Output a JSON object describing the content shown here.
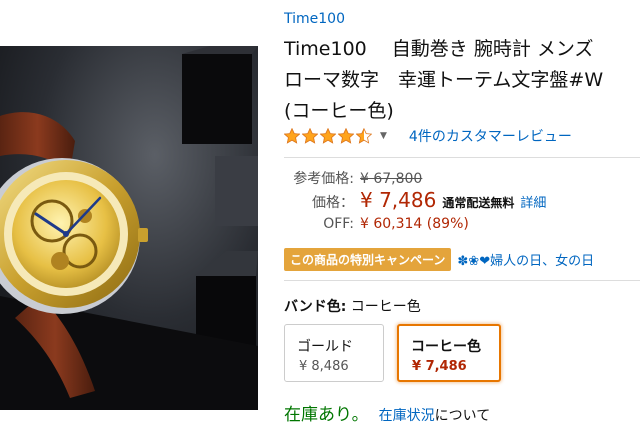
{
  "product": {
    "brand": "Time100",
    "title_lines": [
      "Time100　 自動巻き 腕時計 メンズ",
      "ローマ数字　幸運トーテム文字盤#W",
      "(コーヒー色)"
    ],
    "rating": 4.5,
    "reviews_label": "4件のカスタマーレビュー"
  },
  "pricing": {
    "list_label": "参考価格:",
    "list_price": "¥ 67,800",
    "price_label": "価格：",
    "price": "¥ 7,486",
    "shipping": "通常配送無料",
    "details_link": "詳細",
    "off_label": "OFF:",
    "off_value": "¥ 60,314 (89%)"
  },
  "campaign": {
    "badge": "この商品の特別キャンペーン",
    "promo": "✽❀❤婦人の日、女の日"
  },
  "variants": {
    "label": "バンド色:",
    "selected": "コーヒー色",
    "options": [
      {
        "name": "ゴールド",
        "price": "¥ 8,486"
      },
      {
        "name": "コーヒー色",
        "price": "¥ 7,486"
      }
    ]
  },
  "stock": {
    "status": "在庫あり。",
    "link": "在庫状況",
    "suffix": "について"
  },
  "colors": {
    "link": "#0066c0",
    "price": "#b12704",
    "in_stock": "#007600",
    "badge": "#e4a43b",
    "selected_border": "#e77600",
    "star": "#ffa41c"
  }
}
